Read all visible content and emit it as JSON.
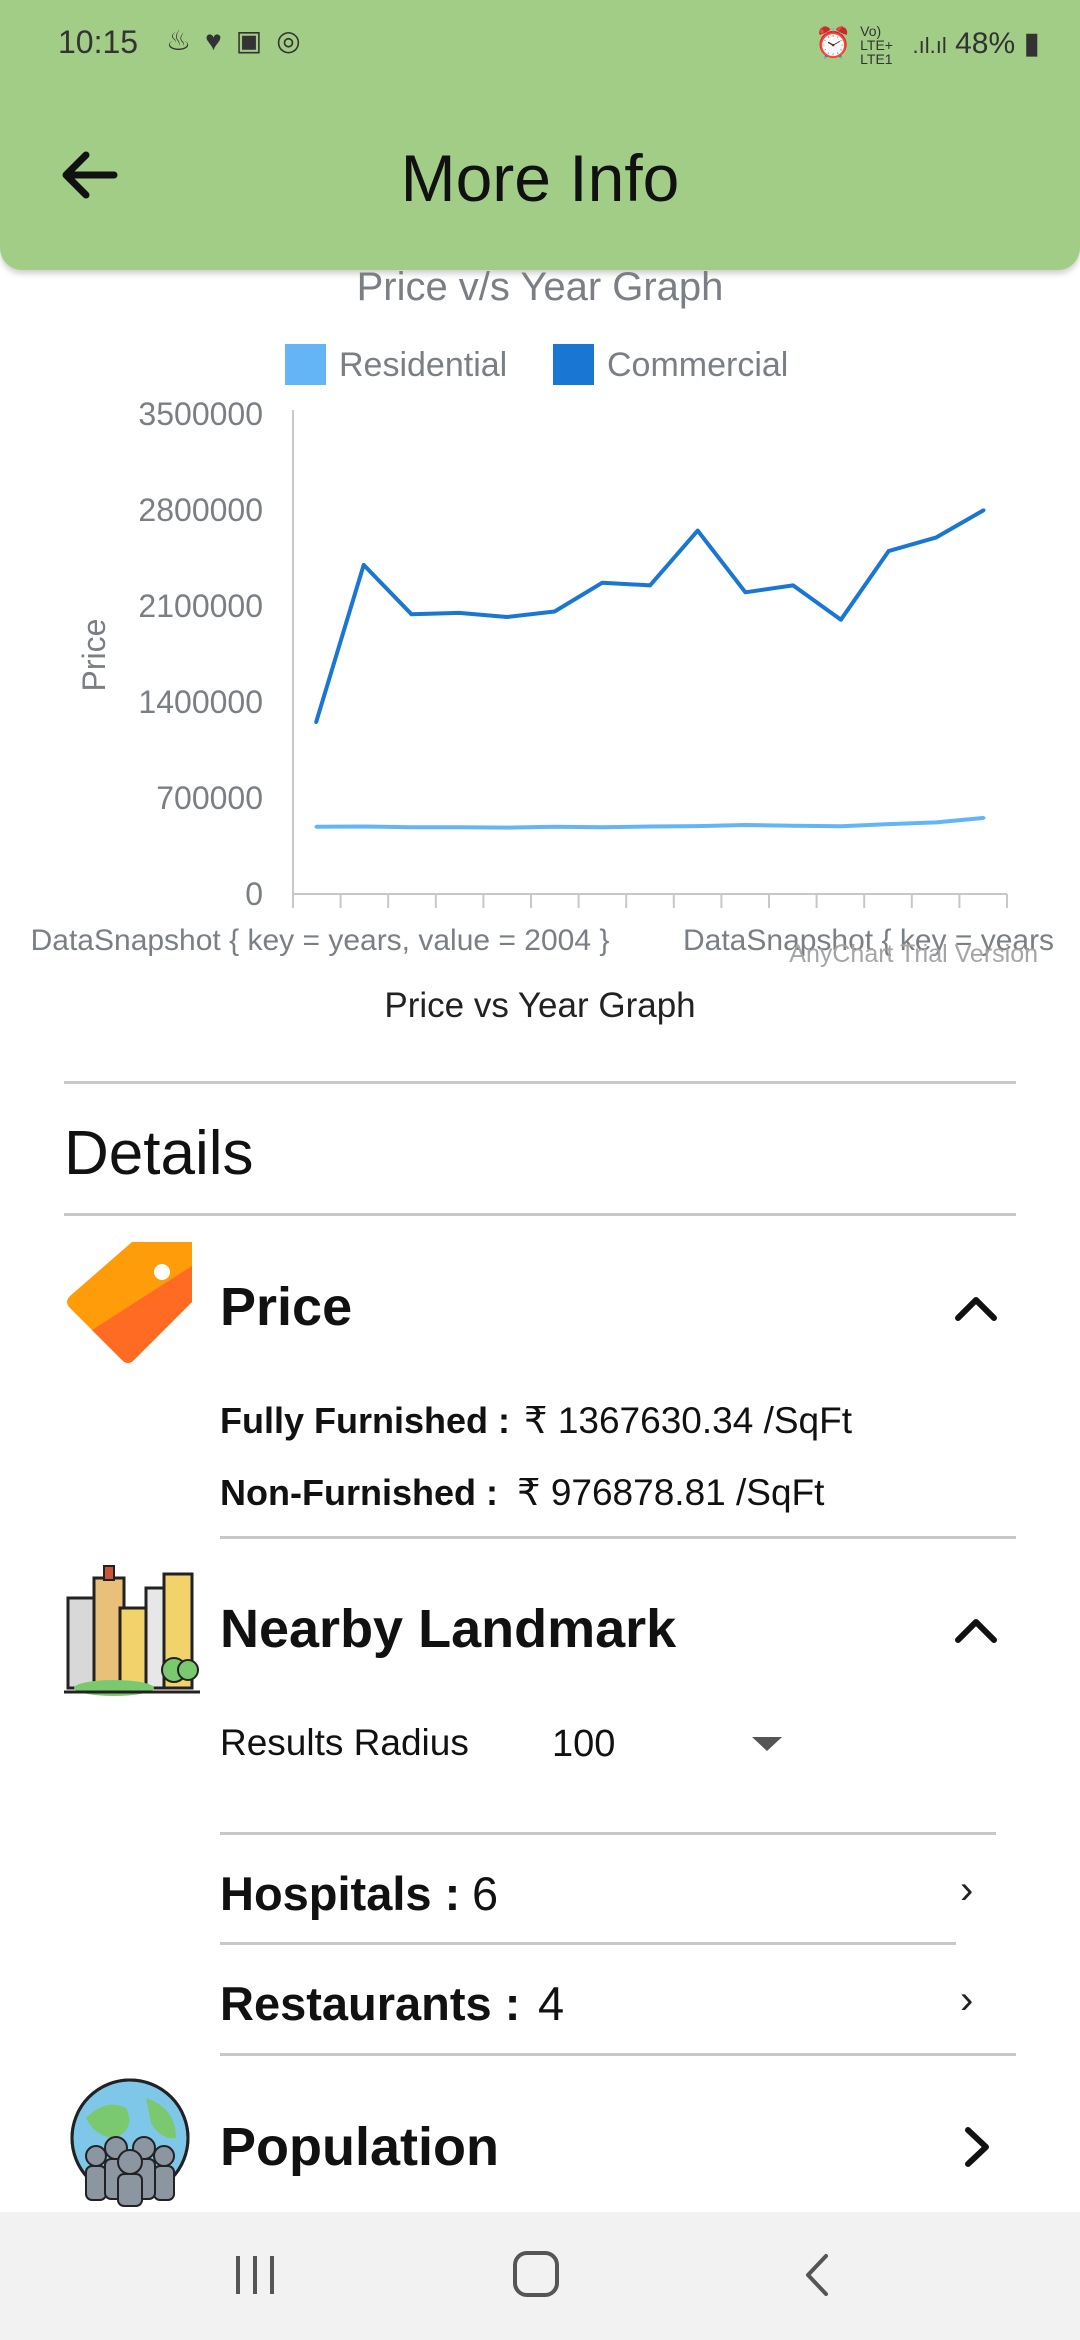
{
  "status_bar": {
    "time": "10:15",
    "left_icons": [
      "notification-icon",
      "health-icon",
      "gallery-icon",
      "sync-icon"
    ],
    "network_label": "Vo) LTE+ LTE1",
    "battery": "48%"
  },
  "app_bar": {
    "title": "More Info",
    "back_icon": "arrow-left-icon",
    "color": "#a2cd87"
  },
  "chart_data": {
    "type": "line",
    "title": "Price v/s Year Graph",
    "ylabel": "Price",
    "xlabel": "",
    "caption": "Price vs Year Graph",
    "watermark": "AnyChart Trial Version",
    "x_tick_labels": [
      "DataSnapshot { key = years, value = 2004 }",
      "DataSnapshot { key = years"
    ],
    "ylim": [
      0,
      3500000
    ],
    "yticks": [
      "3500000",
      "2800000",
      "2100000",
      "1400000",
      "700000",
      "0"
    ],
    "x_count": 15,
    "series": [
      {
        "name": "Residential",
        "color": "#64b5f6",
        "values": [
          490000,
          492000,
          486000,
          486000,
          484000,
          490000,
          487000,
          492000,
          495000,
          503000,
          497000,
          494000,
          510000,
          522000,
          555000
        ]
      },
      {
        "name": "Commercial",
        "color": "#1976d2",
        "values": [
          1250000,
          2400000,
          2040000,
          2050000,
          2020000,
          2060000,
          2270000,
          2250000,
          2650000,
          2200000,
          2250000,
          2000000,
          2500000,
          2600000,
          2800000
        ]
      }
    ],
    "legend_position": "top",
    "grid": false
  },
  "details": {
    "heading": "Details",
    "price": {
      "title": "Price",
      "icon": "price-tag-icon",
      "fully_furnished_label": "Fully Furnished :",
      "fully_furnished_value": "₹ 1367630.34 /SqFt",
      "non_furnished_label": "Non-Furnished :",
      "non_furnished_value": "₹ 976878.81 /SqFt"
    },
    "landmark": {
      "title": "Nearby Landmark",
      "icon": "city-buildings-icon",
      "radius_label": "Results Radius",
      "radius_value": "100",
      "hospitals_label": "Hospitals :",
      "hospitals_count": "6",
      "restaurants_label": "Restaurants :",
      "restaurants_count": "4"
    },
    "population": {
      "title": "Population",
      "icon": "people-globe-icon"
    }
  },
  "nav_bar": {
    "buttons": [
      "recents-icon",
      "home-icon",
      "back-icon"
    ]
  }
}
